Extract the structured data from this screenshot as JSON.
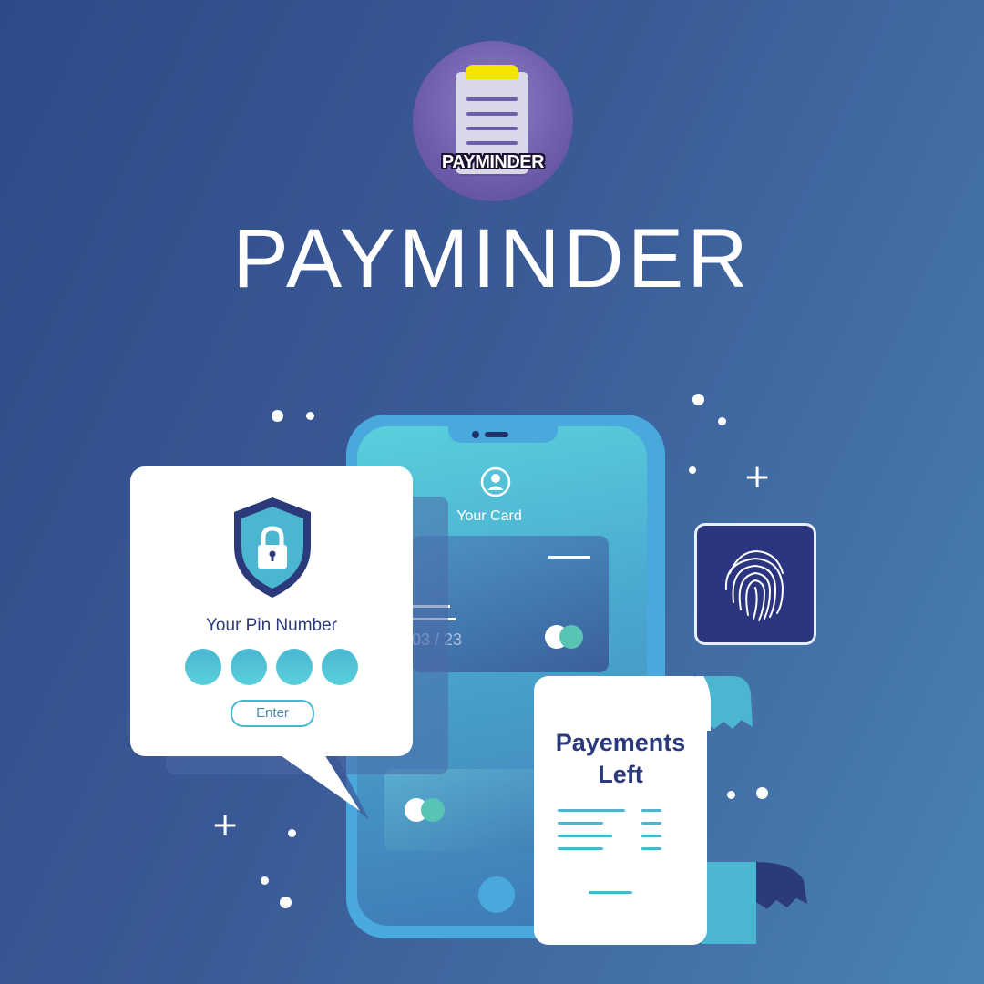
{
  "app": {
    "logo_text": "PAYMINDER",
    "title": "PAYMINDER"
  },
  "phone": {
    "card_title": "Your Card",
    "card_expiry": "03 / 23"
  },
  "pin_panel": {
    "label": "Your Pin Number",
    "enter_label": "Enter",
    "pin_dot_count": 4
  },
  "receipt": {
    "title_line1": "Payements",
    "title_line2": "Left"
  },
  "colors": {
    "accent": "#4ab6d0",
    "navy": "#2b3a7a",
    "logo_clip": "#f2e600"
  },
  "icons": [
    "shield-lock-icon",
    "user-icon",
    "fingerprint-icon",
    "plus-icon"
  ]
}
